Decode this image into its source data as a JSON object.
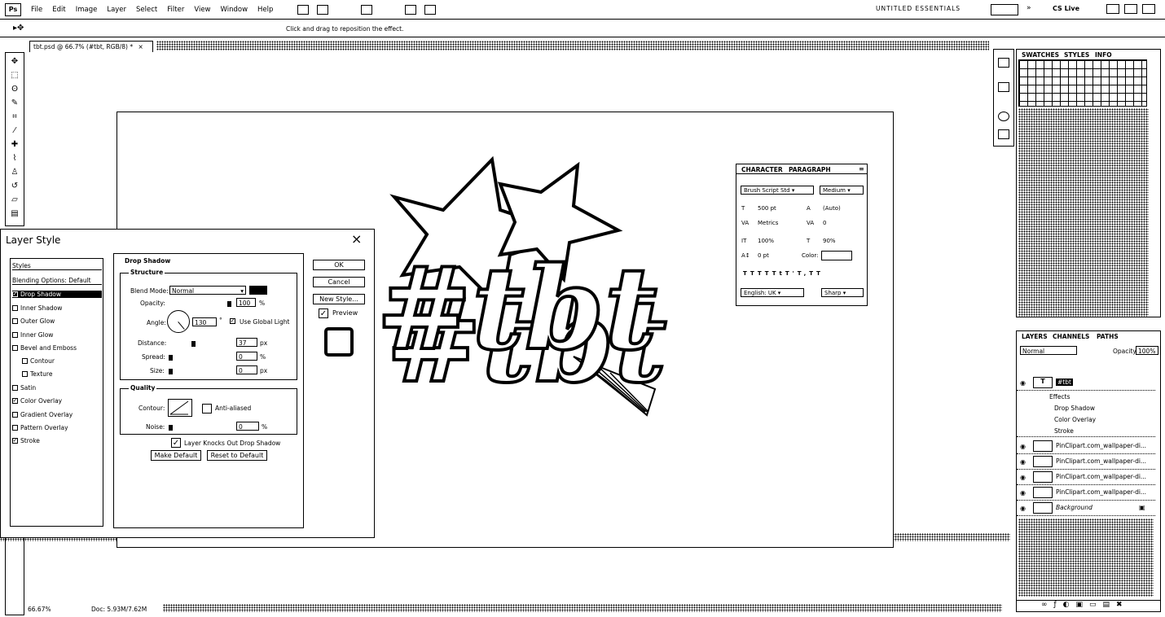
{
  "menubar": {
    "logo": "Ps",
    "items": [
      "File",
      "Edit",
      "Image",
      "Layer",
      "Select",
      "Filter",
      "View",
      "Window",
      "Help"
    ],
    "workspace": "UNTITLED  ESSENTIALS",
    "cslive": "CS Live"
  },
  "options": {
    "hint": "Click and drag to reposition the effect."
  },
  "document": {
    "tab_title": "tbt.psd @ 66.7% (#tbt, RGB/8) *",
    "artwork_text": "#tbt"
  },
  "character_panel": {
    "tabs": [
      "CHARACTER",
      "PARAGRAPH"
    ],
    "font_family": "Brush Script Std",
    "font_style": "Medium",
    "font_size": "500 pt",
    "leading": "(Auto)",
    "kerning": "Metrics",
    "tracking": "0",
    "vertical_scale": "100%",
    "horizontal_scale": "90%",
    "baseline_shift": "0 pt",
    "color_label": "Color:",
    "style_buttons": [
      "T",
      "T",
      "TT",
      "Tt",
      "T'",
      "T,",
      "T",
      "T"
    ],
    "language": "English: UK",
    "antialias": "Sharp"
  },
  "layer_style": {
    "title": "Layer Style",
    "styles_header": "Styles",
    "blending_options": "Blending Options: Default",
    "items": [
      {
        "label": "Drop Shadow",
        "checked": true,
        "selected": true,
        "indent": false
      },
      {
        "label": "Inner Shadow",
        "checked": false,
        "indent": false
      },
      {
        "label": "Outer Glow",
        "checked": false,
        "indent": false
      },
      {
        "label": "Inner Glow",
        "checked": false,
        "indent": false
      },
      {
        "label": "Bevel and Emboss",
        "checked": false,
        "indent": false
      },
      {
        "label": "Contour",
        "checked": false,
        "indent": true
      },
      {
        "label": "Texture",
        "checked": false,
        "indent": true
      },
      {
        "label": "Satin",
        "checked": false,
        "indent": false
      },
      {
        "label": "Color Overlay",
        "checked": true,
        "indent": false
      },
      {
        "label": "Gradient Overlay",
        "checked": false,
        "indent": false
      },
      {
        "label": "Pattern Overlay",
        "checked": false,
        "indent": false
      },
      {
        "label": "Stroke",
        "checked": true,
        "indent": false
      }
    ],
    "section": "Drop Shadow",
    "structure": "Structure",
    "blend_mode_label": "Blend Mode:",
    "blend_mode": "Normal",
    "opacity_label": "Opacity:",
    "opacity": "100",
    "angle_label": "Angle:",
    "angle": "130",
    "global_light": "Use Global Light",
    "distance_label": "Distance:",
    "distance": "37",
    "spread_label": "Spread:",
    "spread": "0",
    "size_label": "Size:",
    "size": "0",
    "quality": "Quality",
    "contour_label": "Contour:",
    "antialiased": "Anti-aliased",
    "noise_label": "Noise:",
    "noise": "0",
    "knockout": "Layer Knocks Out Drop Shadow",
    "make_default": "Make Default",
    "reset_default": "Reset to Default",
    "ok": "OK",
    "cancel": "Cancel",
    "new_style": "New Style...",
    "preview": "Preview",
    "unit_pct": "%",
    "unit_px": "px",
    "unit_deg": "°"
  },
  "swatches_panel": {
    "tabs": [
      "SWATCHES",
      "STYLES",
      "INFO"
    ]
  },
  "layers_panel": {
    "tabs": [
      "LAYERS",
      "CHANNELS",
      "PATHS"
    ],
    "blend": "Normal",
    "opacity_label": "Opacity:",
    "opacity": "100%",
    "layers": [
      {
        "name": "#tbt",
        "type": "text",
        "selected": true
      },
      {
        "name": "Effects",
        "type": "fx"
      },
      {
        "name": "Drop Shadow",
        "type": "effect"
      },
      {
        "name": "Color Overlay",
        "type": "effect"
      },
      {
        "name": "Stroke",
        "type": "effect"
      },
      {
        "name": "PinClipart.com_wallpaper-di...",
        "type": "image"
      },
      {
        "name": "PinClipart.com_wallpaper-di...",
        "type": "image"
      },
      {
        "name": "PinClipart.com_wallpaper-di...",
        "type": "image"
      },
      {
        "name": "PinClipart.com_wallpaper-di...",
        "type": "image"
      },
      {
        "name": "Background",
        "type": "background"
      }
    ]
  },
  "status": {
    "zoom": "66.67%",
    "doc": "Doc: 5.93M/7.62M"
  }
}
